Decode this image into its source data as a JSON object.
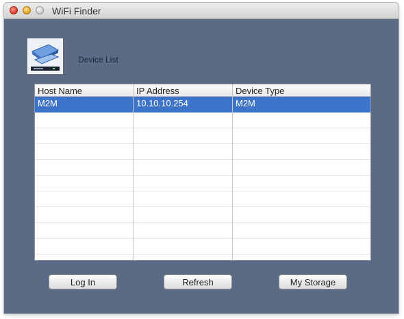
{
  "window": {
    "title": "WiFi Finder"
  },
  "header": {
    "icon": "network-device-icon",
    "label": "Device List"
  },
  "table": {
    "columns": [
      "Host Name",
      "IP Address",
      "Device Type"
    ],
    "rows": [
      {
        "host": "M2M",
        "ip": "10.10.10.254",
        "type": "M2M",
        "selected": true
      }
    ]
  },
  "buttons": {
    "login": "Log In",
    "refresh": "Refresh",
    "storage": "My Storage"
  },
  "colors": {
    "background": "#5c6b85",
    "selection": "#3d74c9"
  }
}
